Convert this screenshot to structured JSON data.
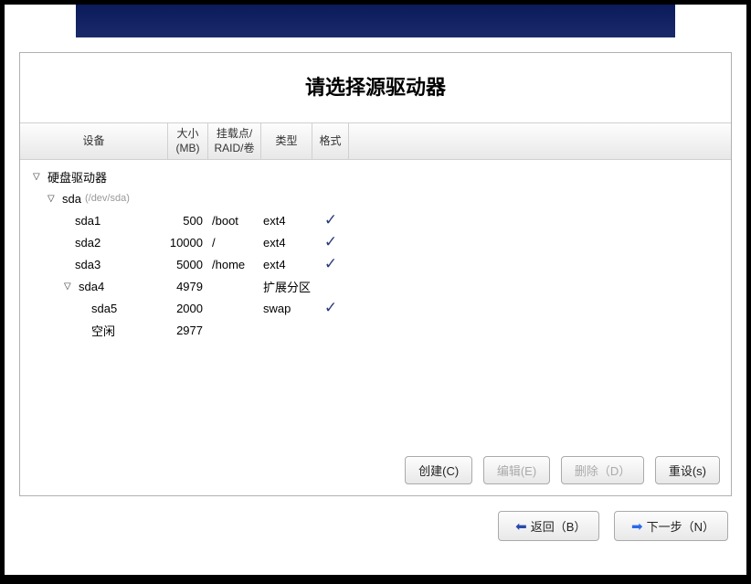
{
  "title": "请选择源驱动器",
  "columns": {
    "device": "设备",
    "size": "大小\n(MB)",
    "mount": "挂载点/\nRAID/卷",
    "type": "类型",
    "format": "格式"
  },
  "tree": {
    "root_label": "硬盘驱动器",
    "disk": {
      "name": "sda",
      "hint": "(/dev/sda)"
    },
    "rows": [
      {
        "name": "sda1",
        "size": "500",
        "mount": "/boot",
        "type": "ext4",
        "fmt": true,
        "level": 2
      },
      {
        "name": "sda2",
        "size": "10000",
        "mount": "/",
        "type": "ext4",
        "fmt": true,
        "level": 2
      },
      {
        "name": "sda3",
        "size": "5000",
        "mount": "/home",
        "type": "ext4",
        "fmt": true,
        "level": 2
      },
      {
        "name": "sda4",
        "size": "4979",
        "mount": "",
        "type": "扩展分区",
        "fmt": false,
        "level": 3,
        "expandable": true
      },
      {
        "name": "sda5",
        "size": "2000",
        "mount": "",
        "type": "swap",
        "fmt": true,
        "level": 4
      },
      {
        "name": "空闲",
        "size": "2977",
        "mount": "",
        "type": "",
        "fmt": false,
        "level": 4
      }
    ]
  },
  "buttons": {
    "create": "创建(C)",
    "edit": "编辑(E)",
    "delete": "删除（D）",
    "reset": "重设(s)",
    "back": "返回（B）",
    "next": "下一步（N）"
  }
}
